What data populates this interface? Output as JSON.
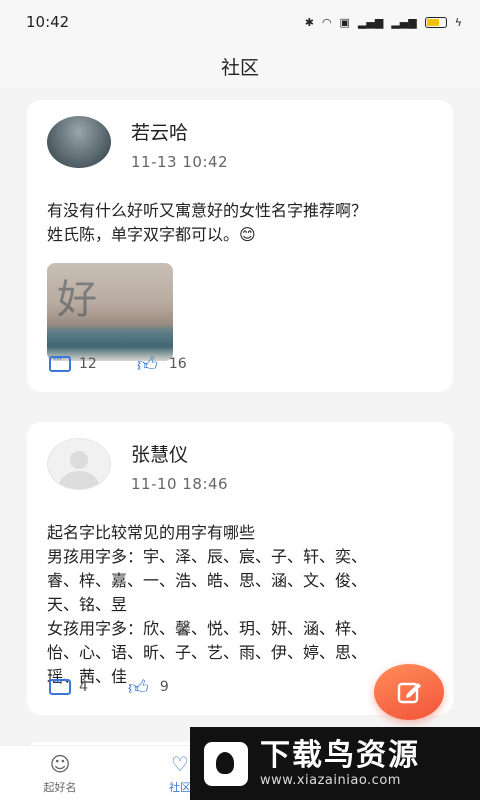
{
  "status_bar": {
    "time": "10:42",
    "icons": [
      "bluetooth-icon",
      "wifi-icon",
      "hd-icon",
      "signal-4g-icon",
      "signal-4g-icon",
      "battery-icon",
      "charging-icon"
    ]
  },
  "header": {
    "title": "社区"
  },
  "posts": [
    {
      "author": "若云哈",
      "time": "11-13 10:42",
      "lines": [
        "有没有什么好听又寓意好的女性名字推荐啊？",
        "姓氏陈，单字双字都可以。😊"
      ],
      "image_text": "好",
      "comments": "12",
      "likes": "16"
    },
    {
      "author": "张慧仪",
      "time": "11-10 18:46",
      "lines": [
        "起名字比较常见的用字有哪些",
        "男孩用字多：宇、泽、辰、宸、子、轩、奕、",
        "睿、梓、嘉、一、浩、皓、思、涵、文、俊、",
        "天、铭、昱",
        "女孩用字多：欣、馨、悦、玥、妍、涵、梓、",
        "怡、心、语、昕、子、艺、雨、伊、婷、思、",
        "瑶、茜、佳"
      ],
      "comments": "4",
      "likes": "9"
    }
  ],
  "tabs": [
    {
      "label": "起好名"
    },
    {
      "label": "社区"
    }
  ],
  "watermark": {
    "title": "下载鸟资源",
    "url": "www.xiazainiao.com"
  },
  "colors": {
    "accent": "#3a78d8",
    "fab": "#f2553a"
  }
}
